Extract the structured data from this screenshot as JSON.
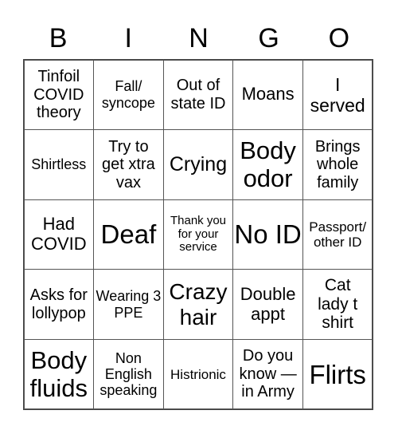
{
  "header": [
    "B",
    "I",
    "N",
    "G",
    "O"
  ],
  "cells": [
    "Tinfoil COVID theory",
    "Fall/ syncope",
    "Out of state ID",
    "Moans",
    "I served",
    "Shirtless",
    "Try to get xtra vax",
    "Crying",
    "Body odor",
    "Brings whole family",
    "Had COVID",
    "Deaf",
    "Thank you for your service",
    "No ID",
    "Passport/ other ID",
    "Asks for lollypop",
    "Wearing 3 PPE",
    "Crazy hair",
    "Double appt",
    "Cat lady t shirt",
    "Body fluids",
    "Non English speaking",
    "Histrionic",
    "Do you know — in Army",
    "Flirts"
  ]
}
